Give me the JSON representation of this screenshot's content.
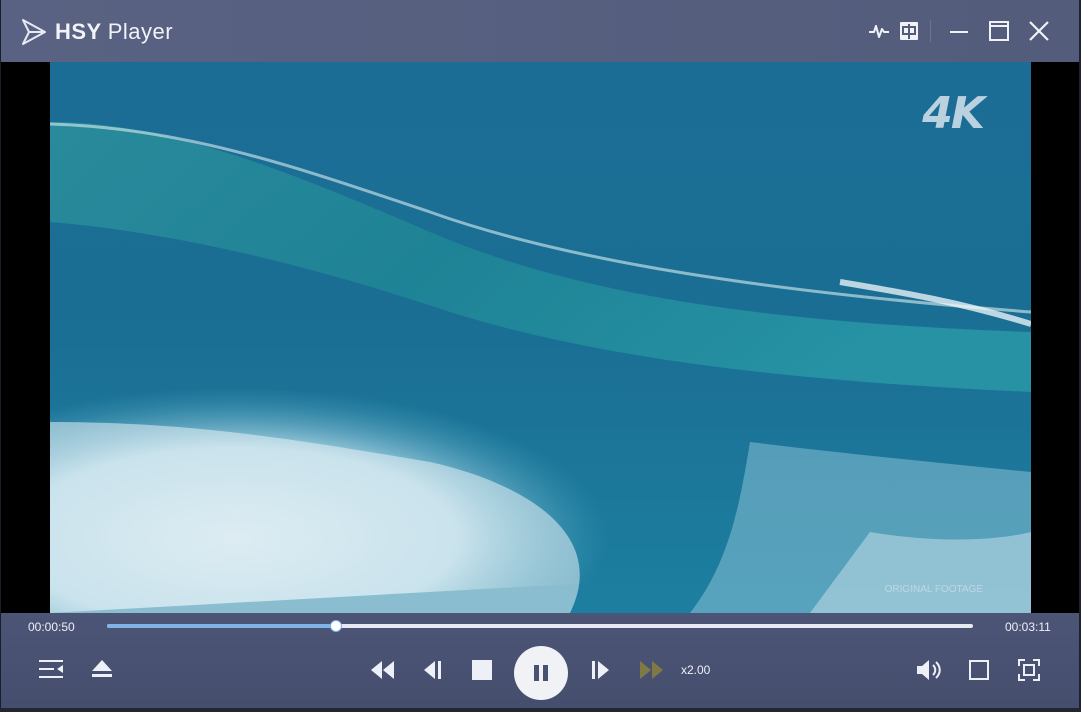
{
  "window": {
    "title_bold": "HSY",
    "title_rest": "Player"
  },
  "titlebar_icons": [
    "waveform-icon",
    "chinese-language-icon",
    "minimize-icon",
    "maximize-icon",
    "close-icon"
  ],
  "video": {
    "badge": "4K",
    "watermark": "ORIGINAL FOOTAGE"
  },
  "playback": {
    "current_time": "00:00:50",
    "total_time": "00:03:11",
    "progress": 0.265,
    "speed": "x2.00",
    "state": "playing"
  },
  "colors": {
    "accent": "#7fb2e6",
    "panel": "#4a5272",
    "fast_forward_disabled": "#7f7a45"
  }
}
